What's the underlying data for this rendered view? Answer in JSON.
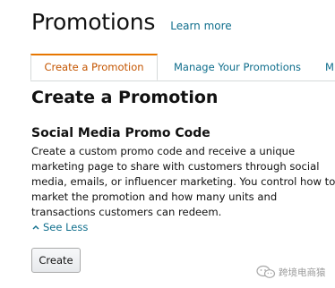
{
  "header": {
    "title": "Promotions",
    "learn_more": "Learn more"
  },
  "tabs": [
    {
      "label": "Create a Promotion",
      "active": true
    },
    {
      "label": "Manage Your Promotions",
      "active": false
    },
    {
      "label": "M",
      "active": false
    }
  ],
  "main": {
    "section_title": "Create a Promotion",
    "card": {
      "title": "Social Media Promo Code",
      "description_lines": [
        "Create a custom promo code and receive a unique",
        "marketing page to share with customers through social",
        "media, emails, or influencer marketing. You control how to",
        "market the promotion and how many units and",
        "transactions customers can redeem."
      ],
      "see_less": "See Less",
      "create_button": "Create"
    }
  },
  "watermark": {
    "text": "跨境电商猿",
    "icon": "wechat-icon"
  },
  "colors": {
    "link": "#0f6e8c",
    "active_tab_text": "#c45500",
    "active_tab_accent": "#e77600",
    "border": "#d5d9d9"
  }
}
